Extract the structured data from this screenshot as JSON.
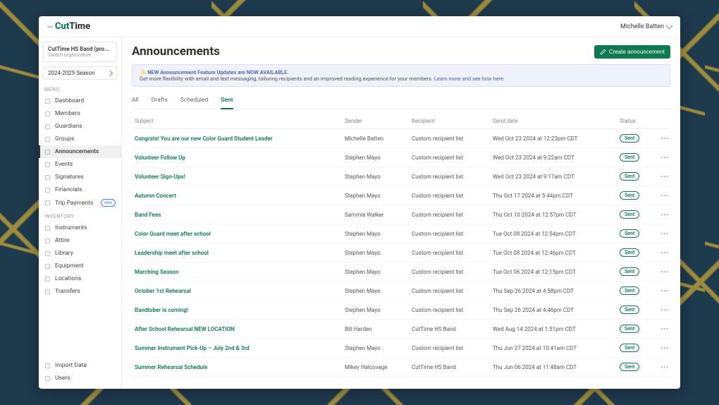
{
  "brand": {
    "part1": "Cut",
    "part2": "Time"
  },
  "header": {
    "user": "Michelle Batten"
  },
  "sidebar": {
    "org": {
      "name": "CutTime HS Band (pro...",
      "switch": "Switch organization"
    },
    "season": "2024-2025 Season",
    "sections": [
      "Menu",
      "Inventory"
    ],
    "menu": [
      {
        "label": "Dashboard",
        "icon": "dashboard-icon",
        "active": false
      },
      {
        "label": "Members",
        "icon": "members-icon",
        "active": false
      },
      {
        "label": "Guardians",
        "icon": "guardians-icon",
        "active": false
      },
      {
        "label": "Groups",
        "icon": "groups-icon",
        "active": false
      },
      {
        "label": "Announcements",
        "icon": "announcements-icon",
        "active": true
      },
      {
        "label": "Events",
        "icon": "events-icon",
        "active": false
      },
      {
        "label": "Signatures",
        "icon": "signatures-icon",
        "active": false
      },
      {
        "label": "Financials",
        "icon": "financials-icon",
        "active": false
      },
      {
        "label": "Trip Payments",
        "icon": "trip-icon",
        "active": false,
        "badge": "new"
      }
    ],
    "inventory": [
      {
        "label": "Instruments",
        "icon": "instruments-icon"
      },
      {
        "label": "Attire",
        "icon": "attire-icon"
      },
      {
        "label": "Library",
        "icon": "library-icon"
      },
      {
        "label": "Equipment",
        "icon": "equipment-icon"
      },
      {
        "label": "Locations",
        "icon": "locations-icon"
      },
      {
        "label": "Transfers",
        "icon": "transfers-icon"
      }
    ],
    "bottom": [
      {
        "label": "Import Data",
        "icon": "import-icon"
      },
      {
        "label": "Users",
        "icon": "users-icon"
      }
    ]
  },
  "page": {
    "title": "Announcements",
    "create_btn": "Create announcement"
  },
  "banner": {
    "headline": "NEW Announcement Feature Updates are NOW AVAILABLE.",
    "body": "Get more flexibility with email and text messaging, tailoring recipients and an improved reading experience for your members.",
    "link": "Learn more and see how here."
  },
  "tabs": [
    {
      "label": "All",
      "active": false
    },
    {
      "label": "Drafts",
      "active": false
    },
    {
      "label": "Scheduled",
      "active": false
    },
    {
      "label": "Sent",
      "active": true
    }
  ],
  "table": {
    "headers": {
      "subject": "Subject",
      "sender": "Sender",
      "recipient": "Recipient",
      "date": "Send date",
      "status": "Status"
    },
    "status_label": "Sent",
    "rows": [
      {
        "subject": "Congrats! You are our new Color Guard Student Leader",
        "sender": "Michelle Batten",
        "recipient": "Custom recipient list",
        "date": "Wed Oct 23 2024 at 12:23pm CDT"
      },
      {
        "subject": "Volunteer Follow Up",
        "sender": "Stephen Mayo",
        "recipient": "Custom recipient list",
        "date": "Wed Oct 23 2024 at 9:22am CDT"
      },
      {
        "subject": "Volunteer Sign-Ups!",
        "sender": "Stephen Mayo",
        "recipient": "Custom recipient list",
        "date": "Wed Oct 23 2024 at 9:17am CDT"
      },
      {
        "subject": "Autumn Concert",
        "sender": "Stephen Mayo",
        "recipient": "Custom recipient list",
        "date": "Thu Oct 17 2024 at 5:44pm CDT"
      },
      {
        "subject": "Band Fees",
        "sender": "Sammie Walker",
        "recipient": "Custom recipient list",
        "date": "Thu Oct 10 2024 at 12:57pm CDT"
      },
      {
        "subject": "Color Guard meet after school",
        "sender": "Stephen Mayo",
        "recipient": "Custom recipient list",
        "date": "Tue Oct 08 2024 at 12:54pm CDT"
      },
      {
        "subject": "Leadership meet after school",
        "sender": "Stephen Mayo",
        "recipient": "Custom recipient list",
        "date": "Tue Oct 08 2024 at 12:46pm CDT"
      },
      {
        "subject": "Marching Season",
        "sender": "Stephen Mayo",
        "recipient": "Custom recipient list",
        "date": "Tue Oct 06 2024 at 12:15pm CDT"
      },
      {
        "subject": "October 1st Rehearsal",
        "sender": "Stephen Mayo",
        "recipient": "Custom recipient list",
        "date": "Thu Sep 26 2024 at 4:58pm CDT"
      },
      {
        "subject": "Bandtober is coming!",
        "sender": "Stephen Mayo",
        "recipient": "Custom recipient list",
        "date": "Thu Sep 26 2024 at 4:46pm CDT"
      },
      {
        "subject": "After School Rehearsal NEW LOCATION",
        "sender": "Bill Harden",
        "recipient": "CutTime HS Band",
        "date": "Wed Aug 14 2024 at 1:51pm CDT"
      },
      {
        "subject": "Summer Instrument Pick-Up – July 2nd & 3rd",
        "sender": "Stephen Mayo",
        "recipient": "Custom recipient list",
        "date": "Thu Jun 27 2024 at 10:41am CDT"
      },
      {
        "subject": "Summer Rehearsal Schedule",
        "sender": "Mikey Halcovage",
        "recipient": "CutTime HS Band",
        "date": "Thu Jun 06 2024 at 11:48am CDT"
      }
    ]
  }
}
